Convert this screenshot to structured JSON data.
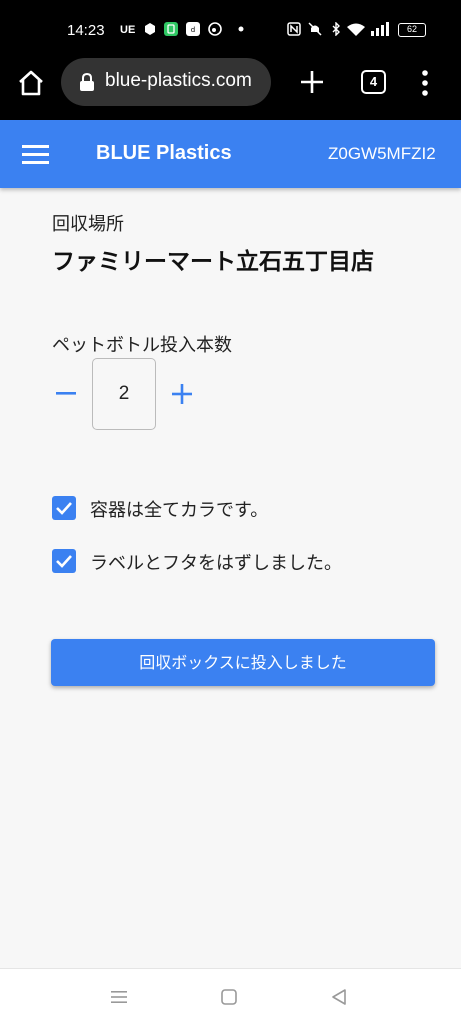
{
  "status_bar": {
    "time": "14:23",
    "carrier_label": "UE",
    "battery_level": "62"
  },
  "browser": {
    "url": "blue-plastics.com",
    "tab_count": "4"
  },
  "app_header": {
    "title": "BLUE Plastics",
    "code": "Z0GW5MFZI2"
  },
  "collection": {
    "location_label": "回収場所",
    "location_name": "ファミリーマート立石五丁目店",
    "count_label": "ペットボトル投入本数",
    "count_value": "2"
  },
  "checklist": [
    {
      "label": "容器は全てカラです。",
      "checked": true
    },
    {
      "label": "ラベルとフタをはずしました。",
      "checked": true
    }
  ],
  "submit_label": "回収ボックスに投入しました",
  "colors": {
    "accent": "#3b81f1",
    "background": "#f7f7f7"
  }
}
